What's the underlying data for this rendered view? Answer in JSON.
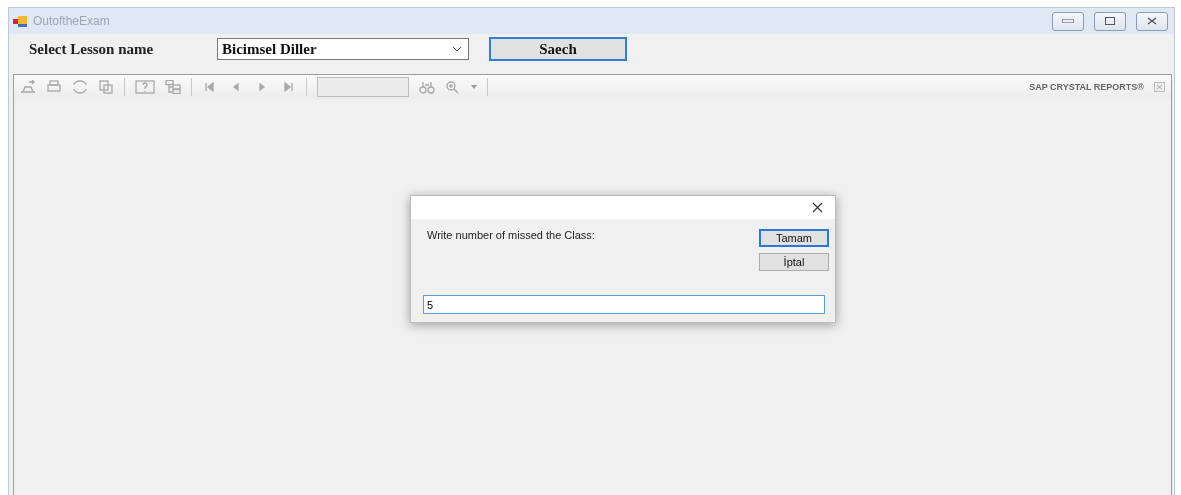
{
  "window": {
    "title": "OutoftheExam"
  },
  "lesson": {
    "label": "Select Lesson name",
    "value": "Bicimsel Diller"
  },
  "search_button": {
    "label": "Saech",
    "focused": true
  },
  "report_viewer": {
    "brand": "SAP CRYSTAL REPORTS®"
  },
  "dialog": {
    "prompt": "Write number of missed the Class:",
    "buttons": [
      {
        "label": "Tamam",
        "default": true
      },
      {
        "label": "İptal",
        "default": false
      }
    ],
    "input": {
      "value": "5"
    }
  }
}
